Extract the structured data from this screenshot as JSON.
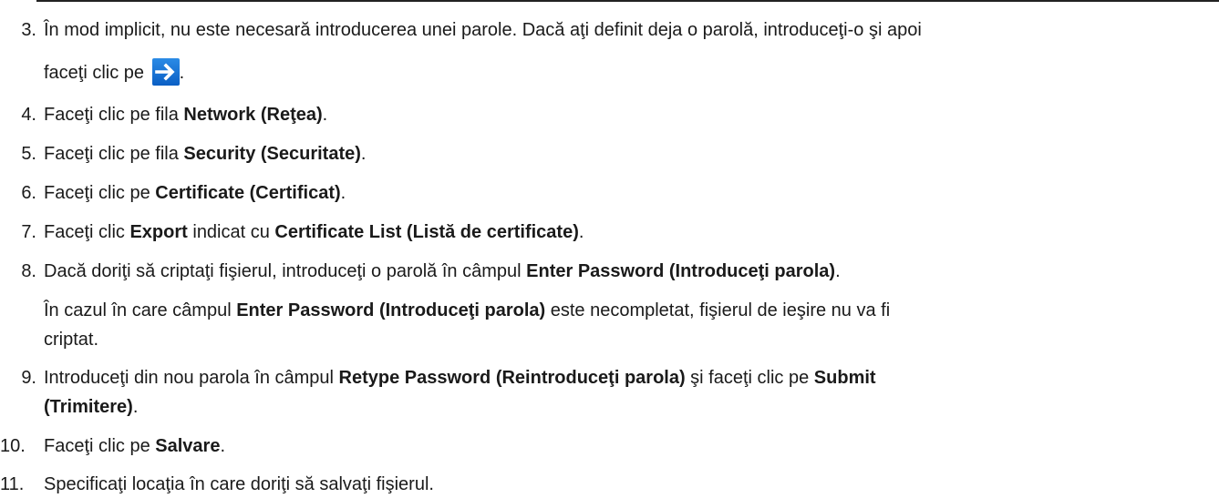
{
  "steps": [
    {
      "number": "3.",
      "line1": "În mod implicit, nu este necesară introducerea unei parole. Dacă aţi definit deja o parolă, introduceţi-o şi apoi",
      "line2_prefix": "faceţi clic pe",
      "line2_suffix": ".",
      "icon": "right-arrow-icon",
      "icon_color": "#1673d6"
    },
    {
      "number": "4.",
      "prefix": "Faceţi clic pe fila ",
      "bold": "Network (Reţea)",
      "suffix": "."
    },
    {
      "number": "5.",
      "prefix": "Faceţi clic pe fila ",
      "bold": "Security (Securitate)",
      "suffix": "."
    },
    {
      "number": "6.",
      "prefix": "Faceţi clic pe ",
      "bold": "Certificate (Certificat)",
      "suffix": "."
    },
    {
      "number": "7.",
      "prefix": "Faceţi clic ",
      "bold1": "Export",
      "middle": " indicat cu ",
      "bold2": "Certificate List (Listă de certificate)",
      "suffix": "."
    },
    {
      "number": "8.",
      "prefix": "Dacă doriţi să criptaţi fişierul, introduceţi o parolă în câmpul ",
      "bold": "Enter Password (Introduceţi parola)",
      "suffix": ".",
      "note_prefix": "În cazul în care câmpul ",
      "note_bold": "Enter Password (Introduceţi parola)",
      "note_suffix_line1": " este necompletat, fişierul de ieşire nu va fi",
      "note_line2": "criptat."
    },
    {
      "number": "9.",
      "prefix": "Introduceţi din nou parola în câmpul ",
      "bold1": "Retype Password (Reintroduceţi parola)",
      "middle": " şi faceţi clic pe ",
      "bold2": "Submit",
      "line2_bold": "(Trimitere)",
      "line2_suffix": "."
    },
    {
      "number": "10.",
      "prefix": "Faceţi clic pe ",
      "bold": "Salvare",
      "suffix": "."
    },
    {
      "number": "11.",
      "text": "Specificaţi locaţia în care doriţi să salvaţi fişierul."
    }
  ]
}
